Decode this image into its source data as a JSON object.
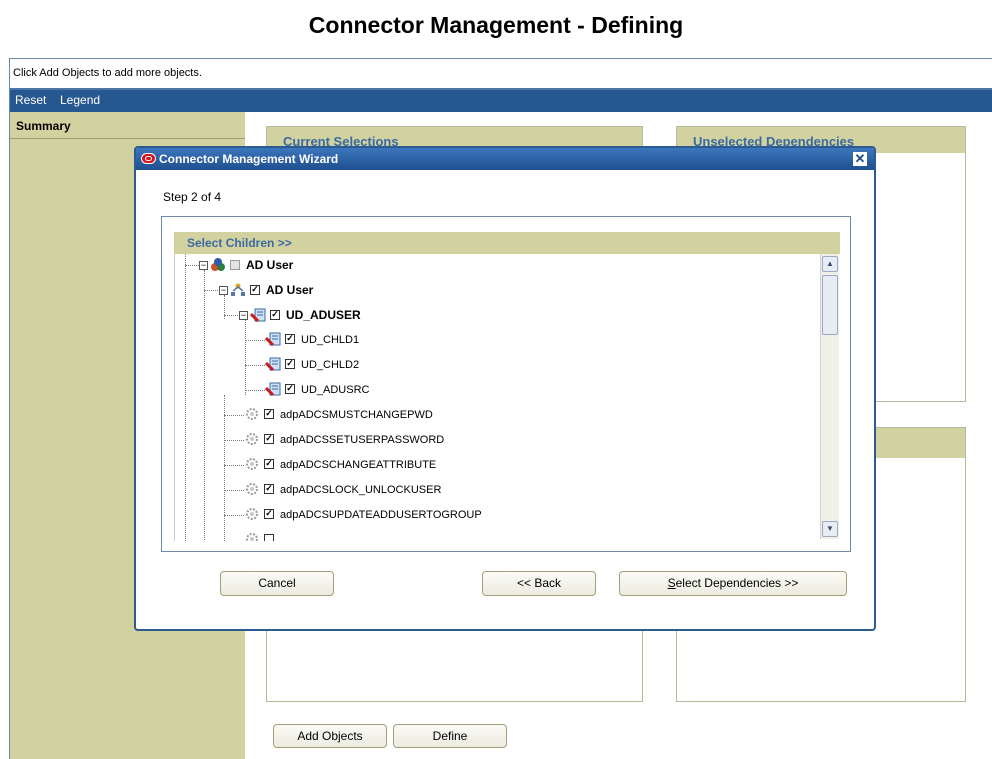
{
  "page": {
    "title": "Connector Management - Defining"
  },
  "info_bar": {
    "text": "Click Add Objects to add more objects."
  },
  "menu": {
    "reset": "Reset",
    "legend": "Legend"
  },
  "sidebar": {
    "title": "Summary"
  },
  "panels": {
    "current_selections": "Current Selections",
    "unselected_dependencies": "Unselected Dependencies"
  },
  "buttons": {
    "add_objects": "Add Objects",
    "define": "Define"
  },
  "wizard": {
    "title": "Connector Management Wizard",
    "step": "Step 2 of 4",
    "section_title": "Select Children >>",
    "close_glyph": "✕",
    "buttons": {
      "cancel": "Cancel",
      "back": "<< Back",
      "select_dependencies_prefix": "S",
      "select_dependencies_rest": "elect Dependencies >>"
    },
    "tree": [
      {
        "label": "AD User",
        "checked": "partial",
        "icon": "resource-object-icon"
      },
      {
        "label": "AD User",
        "checked": true,
        "icon": "process-form-icon"
      },
      {
        "label": "UD_ADUSER",
        "checked": true,
        "icon": "form-icon"
      },
      {
        "label": "UD_CHLD1",
        "checked": true,
        "icon": "form-icon"
      },
      {
        "label": "UD_CHLD2",
        "checked": true,
        "icon": "form-icon"
      },
      {
        "label": "UD_ADUSRC",
        "checked": true,
        "icon": "form-icon"
      },
      {
        "label": "adpADCSMUSTCHANGEPWD",
        "checked": true,
        "icon": "adapter-icon"
      },
      {
        "label": "adpADCSSETUSERPASSWORD",
        "checked": true,
        "icon": "adapter-icon"
      },
      {
        "label": "adpADCSCHANGEATTRIBUTE",
        "checked": true,
        "icon": "adapter-icon"
      },
      {
        "label": "adpADCSLOCK_UNLOCKUSER",
        "checked": true,
        "icon": "adapter-icon"
      },
      {
        "label": "adpADCSUPDATEADDUSERTOGROUP",
        "checked": true,
        "icon": "adapter-icon"
      }
    ]
  }
}
